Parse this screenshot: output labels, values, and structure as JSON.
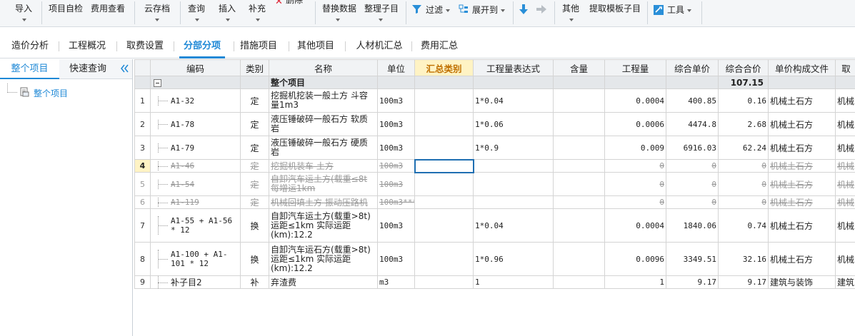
{
  "toolbar": {
    "import": "导入",
    "self_check": "项目自检",
    "fee_view": "费用查看",
    "cloud_save": "云存档",
    "query": "查询",
    "insert": "插入",
    "supplement": "补充",
    "delete": "删除",
    "replace_data": "替换数据",
    "organize_sub": "整理子目",
    "filter": "过滤",
    "expand_to": "展开到",
    "other": "其他",
    "extract_template": "提取模板子目",
    "tools": "工具"
  },
  "tabs": [
    {
      "label": "造价分析"
    },
    {
      "label": "工程概况"
    },
    {
      "label": "取费设置"
    },
    {
      "label": "分部分项"
    },
    {
      "label": "措施项目"
    },
    {
      "label": "其他项目"
    },
    {
      "label": "人材机汇总"
    },
    {
      "label": "费用汇总"
    }
  ],
  "left_panel": {
    "tabs": [
      {
        "label": "整个项目"
      },
      {
        "label": "快速查询"
      }
    ],
    "tree_item": "整个项目"
  },
  "grid": {
    "columns": [
      "编码",
      "类别",
      "名称",
      "单位",
      "汇总类别",
      "工程量表达式",
      "含量",
      "工程量",
      "综合单价",
      "综合合价",
      "单价构成文件",
      "取"
    ],
    "group_row": {
      "name": "整个项目",
      "total": "107.15"
    },
    "rows": [
      {
        "num": "1",
        "code": "A1-32",
        "type": "定",
        "name": "挖掘机挖装一般土方 斗容量1m3",
        "unit": "100m3",
        "expr": "1*0.04",
        "qty": "0.0004",
        "price": "400.85",
        "total": "0.16",
        "file": "机械土石方",
        "fee": "机械"
      },
      {
        "num": "2",
        "code": "A1-78",
        "type": "定",
        "name": "液压锤破碎一般石方 软质岩",
        "unit": "100m3",
        "expr": "1*0.06",
        "qty": "0.0006",
        "price": "4474.8",
        "total": "2.68",
        "file": "机械土石方",
        "fee": "机械"
      },
      {
        "num": "3",
        "code": "A1-79",
        "type": "定",
        "name": "液压锤破碎一般石方 硬质岩",
        "unit": "100m3",
        "expr": "1*0.9",
        "qty": "0.009",
        "price": "6916.03",
        "total": "62.24",
        "file": "机械土石方",
        "fee": "机械"
      },
      {
        "num": "4",
        "code": "A1-46",
        "type": "定",
        "name": "挖掘机装车 土方",
        "unit": "100m3",
        "expr": "",
        "qty": "0",
        "price": "0",
        "total": "0",
        "file": "机械土石方",
        "fee": "机械"
      },
      {
        "num": "5",
        "code": "A1-54",
        "type": "定",
        "name": "自卸汽车运土方(载重≤8t 每增运1km",
        "unit": "100m3",
        "expr": "",
        "qty": "0",
        "price": "0",
        "total": "0",
        "file": "机械土石方",
        "fee": "机械"
      },
      {
        "num": "6",
        "code": "A1-119",
        "type": "定",
        "name": "机械回填土方 振动压路机",
        "unit": "100m3***",
        "expr": "",
        "qty": "0",
        "price": "0",
        "total": "0",
        "file": "机械土石方",
        "fee": "机械"
      },
      {
        "num": "7",
        "code": "A1-55 + A1-56 * 12",
        "type": "换",
        "name": "自卸汽车运土方(载重>8t) 运距≤1km  实际运距(km):12.2",
        "unit": "100m3",
        "expr": "1*0.04",
        "qty": "0.0004",
        "price": "1840.06",
        "total": "0.74",
        "file": "机械土石方",
        "fee": "机械"
      },
      {
        "num": "8",
        "code": "A1-100 + A1-101 * 12",
        "type": "换",
        "name": "自卸汽车运石方(载重>8t) 运距≤1km  实际运距(km):12.2",
        "unit": "100m3",
        "expr": "1*0.96",
        "qty": "0.0096",
        "price": "3349.51",
        "total": "32.16",
        "file": "机械土石方",
        "fee": "机械"
      },
      {
        "num": "9",
        "code": "补子目2",
        "type": "补",
        "name": "弃渣费",
        "unit": "m3",
        "expr": "1",
        "qty": "1",
        "price": "9.17",
        "total": "9.17",
        "file": "建筑与装饰",
        "fee": "建筑"
      }
    ]
  }
}
